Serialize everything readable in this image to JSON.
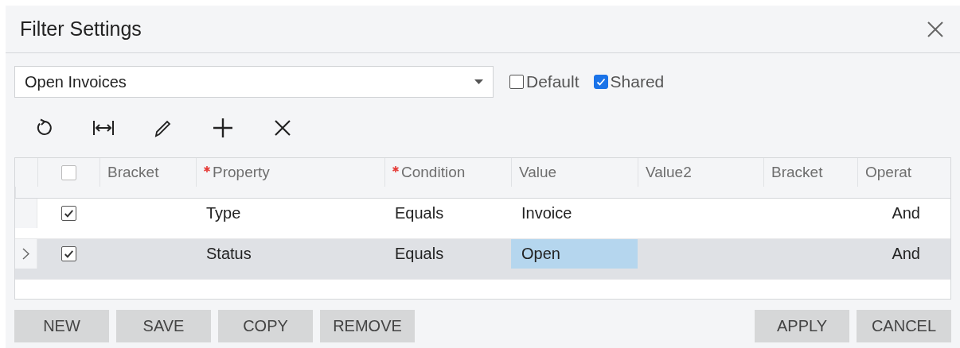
{
  "window": {
    "title": "Filter Settings"
  },
  "filter": {
    "value": "Open Invoices"
  },
  "options": [
    {
      "label": "Default",
      "checked": false
    },
    {
      "label": "Shared",
      "checked": true
    }
  ],
  "table": {
    "all_checked": false,
    "columns": [
      {
        "label": "Bracket",
        "required": false
      },
      {
        "label": "Property",
        "required": true
      },
      {
        "label": "Condition",
        "required": true
      },
      {
        "label": "Value",
        "required": false
      },
      {
        "label": "Value2",
        "required": false
      },
      {
        "label": "Bracket",
        "required": false
      },
      {
        "label": "Operat",
        "required": false
      }
    ],
    "rows": [
      {
        "selected": false,
        "checked": true,
        "property": "Type",
        "condition": "Equals",
        "value": "Invoice",
        "value_selected": false,
        "operator": "And"
      },
      {
        "selected": true,
        "checked": true,
        "property": "Status",
        "condition": "Equals",
        "value": "Open",
        "value_selected": true,
        "operator": "And"
      }
    ]
  },
  "left_buttons": [
    "NEW",
    "SAVE",
    "COPY",
    "REMOVE"
  ],
  "right_buttons": [
    "APPLY",
    "CANCEL"
  ]
}
